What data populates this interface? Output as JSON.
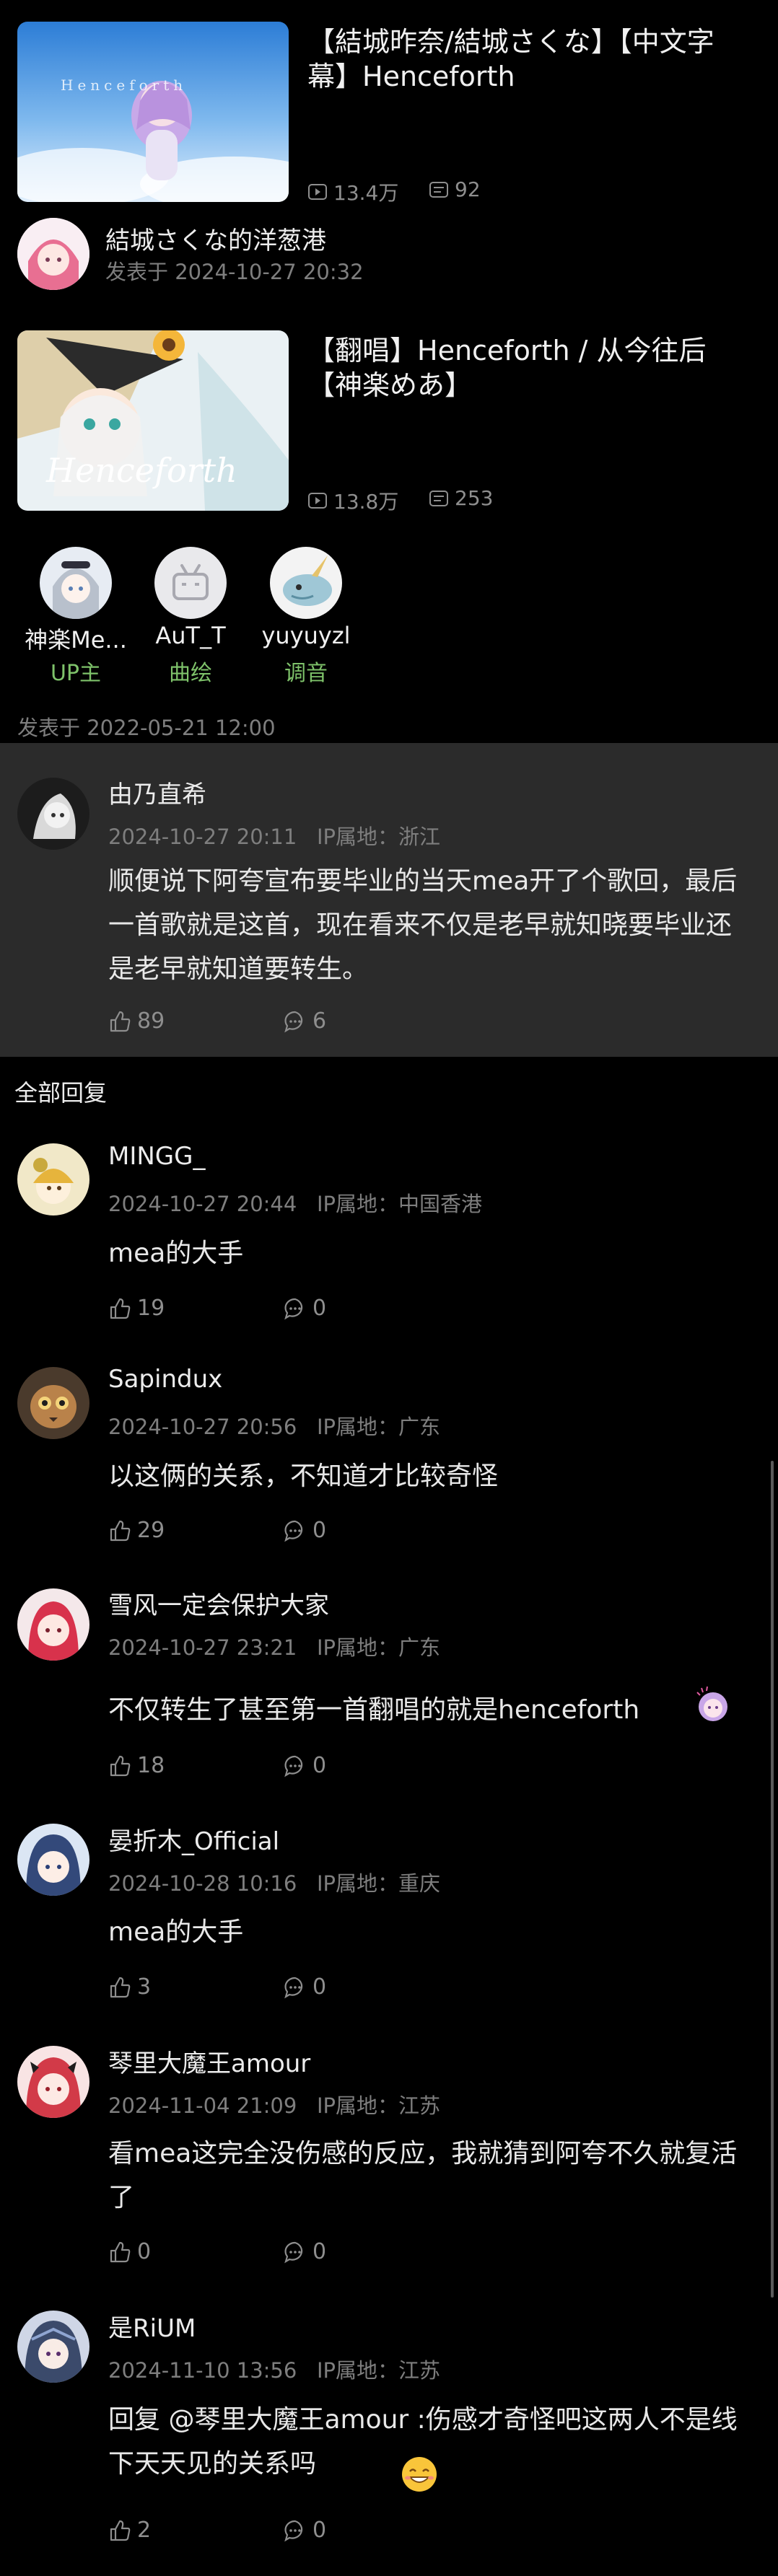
{
  "videos": [
    {
      "title": "【結城昨奈/結城さくな】【中文字幕】Henceforth",
      "plays": "13.4万",
      "comments": "92"
    },
    {
      "title": "【翻唱】Henceforth / 从今往后【神楽めあ】",
      "plays": "13.8万",
      "comments": "253"
    }
  ],
  "post_author": {
    "name": "結城さくな的洋葱港",
    "posted": "发表于 2024-10-27 20:32"
  },
  "staff": [
    {
      "name": "神楽Me...",
      "role": "UP主"
    },
    {
      "name": "AuT_T",
      "role": "曲绘"
    },
    {
      "name": "yuyuyzl",
      "role": "调音"
    }
  ],
  "staff_posted": "发表于 2022-05-21 12:00",
  "main_comment": {
    "user": "由乃直希",
    "meta": "2024-10-27 20:11   IP属地：浙江",
    "text": "顺便说下阿夸宣布要毕业的当天mea开了个歌回，最后一首歌就是这首，现在看来不仅是老早就知晓要毕业还是老早就知道要转生。",
    "likes": "89",
    "replies": "6"
  },
  "all_replies_label": "全部回复",
  "replies": [
    {
      "user": "MINGG_",
      "meta": "2024-10-27 20:44   IP属地：中国香港",
      "text": "mea的大手",
      "likes": "19",
      "replies": "0"
    },
    {
      "user": "Sapindux",
      "meta": "2024-10-27 20:56   IP属地：广东",
      "text": "以这俩的关系，不知道才比较奇怪",
      "likes": "29",
      "replies": "0"
    },
    {
      "user": "雪风一定会保护大家",
      "meta": "2024-10-27 23:21   IP属地：广东",
      "text": "不仅转生了甚至第一首翻唱的就是henceforth",
      "likes": "18",
      "replies": "0"
    },
    {
      "user": "晏折木_Official",
      "meta": "2024-10-28 10:16   IP属地：重庆",
      "text": "mea的大手",
      "likes": "3",
      "replies": "0"
    },
    {
      "user": "琴里大魔王amour",
      "meta": "2024-11-04 21:09   IP属地：江苏",
      "text": "看mea这完全没伤感的反应，我就猜到阿夸不久就复活了",
      "likes": "0",
      "replies": "0"
    },
    {
      "user": "是RiUM",
      "meta": "2024-11-10 13:56   IP属地：江苏",
      "text": "回复 @琴里大魔王amour :伤感才奇怪吧这两人不是线下天天见的关系吗",
      "likes": "2",
      "replies": "0"
    }
  ],
  "colors": {
    "background": "#000000",
    "highlight": "#2b2b2b",
    "role": "#7ec26a",
    "meta": "#7e7e7e"
  }
}
